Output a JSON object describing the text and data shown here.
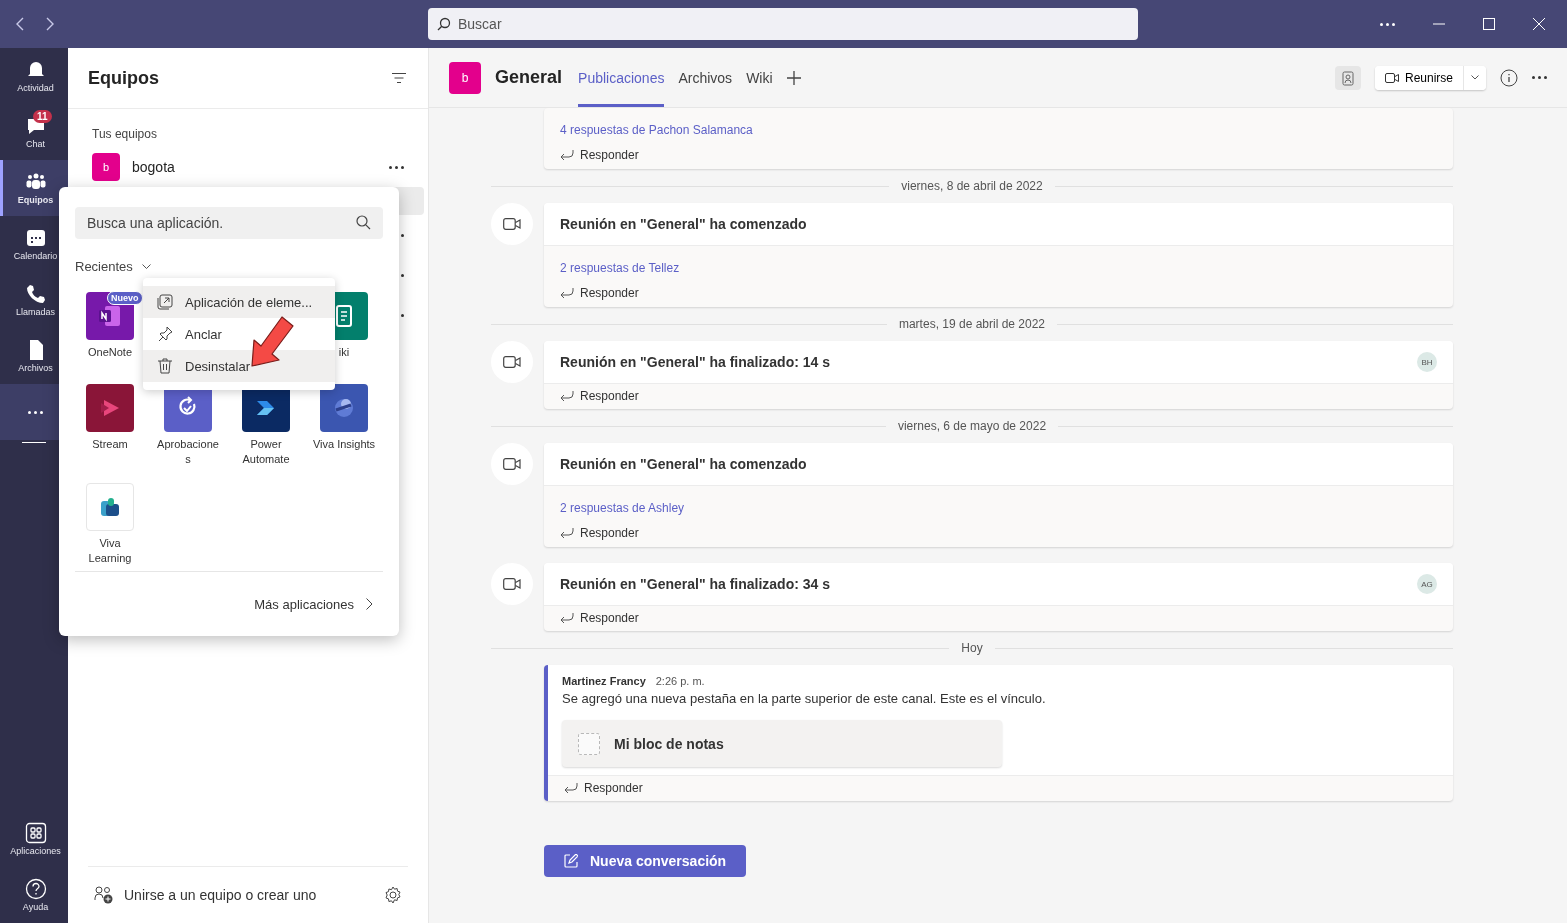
{
  "titlebar": {
    "search": {
      "placeholder": "Buscar"
    }
  },
  "rail": [
    {
      "label": "Actividad",
      "selected": false
    },
    {
      "label": "Chat",
      "selected": false,
      "badge": "11"
    },
    {
      "label": "Equipos",
      "selected": true
    },
    {
      "label": "Calendario",
      "selected": false
    },
    {
      "label": "Llamadas",
      "selected": false
    },
    {
      "label": "Archivos",
      "selected": false
    }
  ],
  "rail_bottom": [
    {
      "label": "Aplicaciones"
    },
    {
      "label": "Ayuda"
    }
  ],
  "teams_panel": {
    "title": "Equipos",
    "section": "Tus equipos",
    "rows": [
      {
        "kind": "team",
        "name": "bogota",
        "avatar": "b",
        "selected": false
      },
      {
        "kind": "channel",
        "selected": true
      },
      {
        "kind": "team",
        "selected": false
      },
      {
        "kind": "team",
        "selected": false
      },
      {
        "kind": "team",
        "selected": false
      }
    ],
    "footer": "Unirse a un equipo o crear uno"
  },
  "app_picker": {
    "search": {
      "placeholder": "Busca una aplicación."
    },
    "section": "Recientes",
    "apps": [
      {
        "kind": "onenote",
        "name": "OneNote",
        "color": "#7719aa",
        "badge": "Nuevo"
      },
      {
        "kind": "hidden"
      },
      {
        "kind": "hidden"
      },
      {
        "kind": "wiki",
        "name": "iki",
        "color": "#037f6c"
      },
      {
        "kind": "stream",
        "name": "Stream",
        "color": "#8a1538"
      },
      {
        "kind": "approvals",
        "name": "Aprobaciones",
        "color": "#5b5fc7"
      },
      {
        "kind": "automate",
        "name": "Power Automate",
        "color": "#0b2a63"
      },
      {
        "kind": "insights",
        "name": "Viva Insights",
        "color": "#3b56b0"
      },
      {
        "kind": "learning",
        "name": "Viva Learning",
        "color": "#ffffff"
      }
    ],
    "more": "Más aplicaciones",
    "menu": [
      {
        "label": "Aplicación de eleme...",
        "highlighted": true
      },
      {
        "label": "Anclar",
        "highlighted": false
      },
      {
        "label": "Desinstalar",
        "highlighted": true
      }
    ]
  },
  "channel": {
    "avatar": "b",
    "name": "General",
    "tabs": [
      {
        "label": "Publicaciones",
        "selected": true
      },
      {
        "label": "Archivos",
        "selected": false
      },
      {
        "label": "Wiki",
        "selected": false
      }
    ],
    "meet_button": "Reunirse"
  },
  "feed": [
    {
      "kind": "partial",
      "replies": "4 respuestas de Pachon Salamanca",
      "reply": "Responder"
    },
    {
      "kind": "date",
      "text": "viernes, 8 de abril de 2022"
    },
    {
      "kind": "meeting",
      "title": "Reunión en \"General\" ha comenzado",
      "replies": "2 respuestas de Tellez",
      "reply": "Responder"
    },
    {
      "kind": "date",
      "text": "martes, 19 de abril de 2022"
    },
    {
      "kind": "meeting",
      "title": "Reunión en \"General\" ha finalizado: 14 s",
      "initials": "BH",
      "reply": "Responder"
    },
    {
      "kind": "date",
      "text": "viernes, 6 de mayo de 2022"
    },
    {
      "kind": "meeting",
      "title": "Reunión en \"General\" ha comenzado",
      "replies": "2 respuestas de Ashley",
      "reply": "Responder"
    },
    {
      "kind": "meeting",
      "title": "Reunión en \"General\" ha finalizado: 34 s",
      "initials": "AG",
      "reply": "Responder"
    },
    {
      "kind": "date",
      "text": "Hoy"
    },
    {
      "kind": "message",
      "author": "Martinez Francy",
      "time": "2:26 p. m.",
      "text": "Se agregó una nueva pestaña en la parte superior de este canal. Este es el vínculo.",
      "attachment": "Mi bloc de notas",
      "reply": "Responder"
    }
  ],
  "new_post": "Nueva conversación"
}
